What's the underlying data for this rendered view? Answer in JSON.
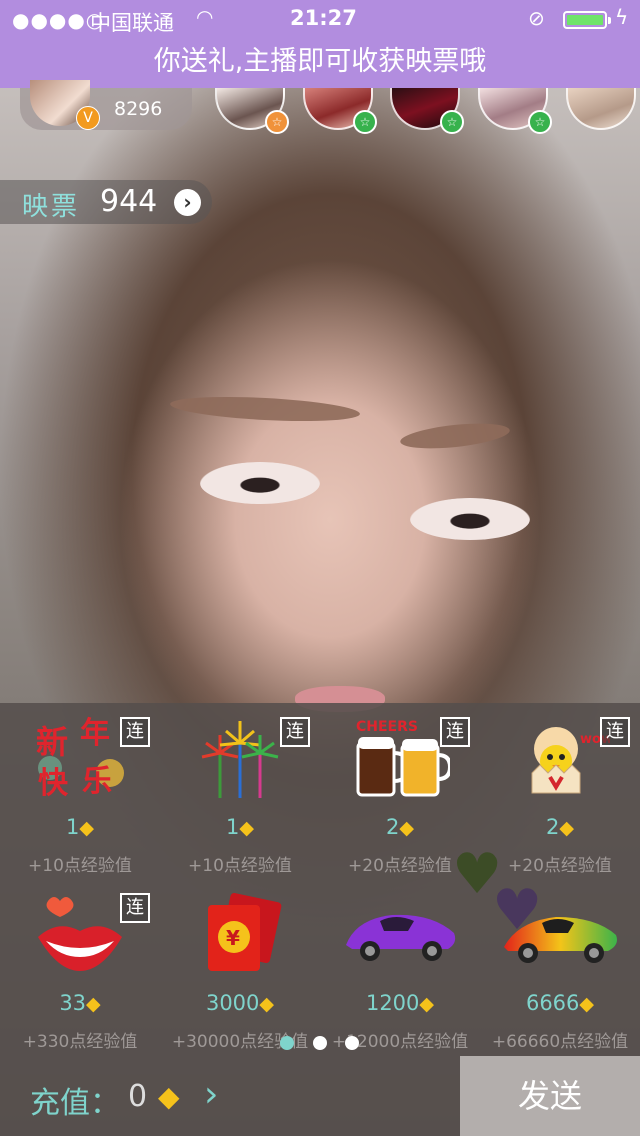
{
  "status_bar": {
    "signal": "●●●●○",
    "carrier": "中国联通",
    "wifi": "wifi-icon",
    "time": "21:27",
    "lock": "rotation-lock-icon",
    "charging": "bolt-icon"
  },
  "banner": {
    "text": "你送礼,主播即可收获映票哦"
  },
  "host": {
    "count": "8296",
    "badge": "V"
  },
  "viewers": [
    {
      "badge": "☆",
      "color": "#f0923a"
    },
    {
      "badge": "☆",
      "color": "#37b24d"
    },
    {
      "badge": "☆",
      "color": "#37b24d"
    },
    {
      "badge": "☆",
      "color": "#37b24d"
    },
    {
      "badge": "",
      "color": ""
    }
  ],
  "ticket": {
    "label": "映票",
    "value": "944",
    "arrow": "›"
  },
  "gifts": [
    {
      "name": "新年快乐",
      "price": "1",
      "exp": "+10点经验值",
      "lian": "连"
    },
    {
      "name": "烟花",
      "price": "1",
      "exp": "+10点经验值",
      "lian": "连"
    },
    {
      "name": "CHEERS",
      "price": "2",
      "exp": "+20点经验值",
      "lian": "连"
    },
    {
      "name": "wow",
      "price": "2",
      "exp": "+20点经验值",
      "lian": "连"
    },
    {
      "name": "lips",
      "price": "33",
      "exp": "+330点经验值",
      "lian": "连"
    },
    {
      "name": "¥",
      "price": "3000",
      "exp": "+30000点经验值",
      "lian": ""
    },
    {
      "name": "purple-car",
      "price": "1200",
      "exp": "+12000点经验值",
      "lian": ""
    },
    {
      "name": "sports-car",
      "price": "6666",
      "exp": "+66660点经验值",
      "lian": ""
    }
  ],
  "pager": {
    "count": 3,
    "active": 0
  },
  "footer": {
    "recharge_label": "充值：",
    "recharge_value": "0",
    "send_label": "发送"
  },
  "colors": {
    "accent": "#b28ddf",
    "teal": "#7fd4cc",
    "diamond": "#f5c21b"
  }
}
